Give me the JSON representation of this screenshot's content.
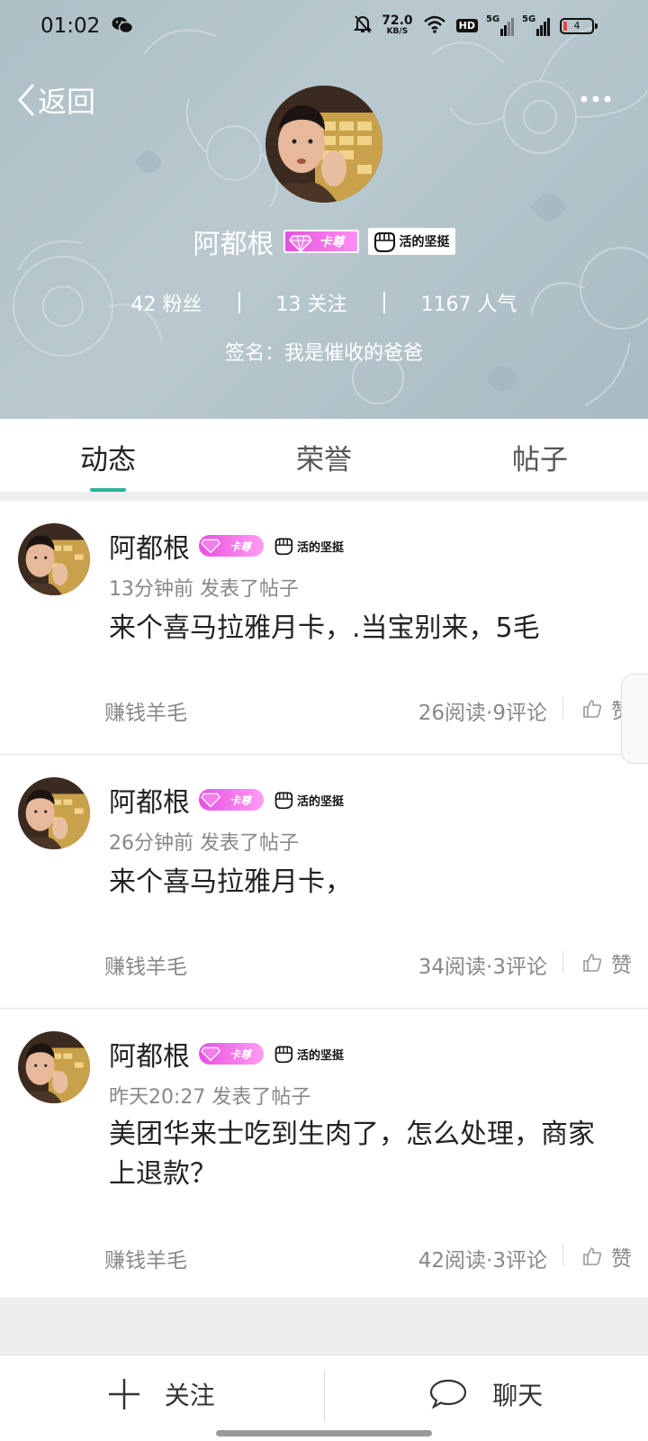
{
  "status_bar": {
    "time": "01:02",
    "net_speed_value": "72.0",
    "net_speed_unit": "KB/S",
    "hd_label": "HD",
    "signal_1_label": "5G",
    "signal_2_label": "5G",
    "battery_level": "4",
    "icons": [
      "wechat-icon",
      "mute-bell-icon",
      "wifi-icon",
      "signal-icon",
      "battery-icon"
    ]
  },
  "nav": {
    "back_label": "返回",
    "more_icon": "more-dots-icon"
  },
  "profile": {
    "name": "阿都根",
    "vip_badge_text": "卡尊",
    "motto_badge_text": "活的坚挺",
    "stats": {
      "fans": "42 粉丝",
      "following": "13 关注",
      "popularity": "1167 人气"
    },
    "signature": "签名：我是催收的爸爸"
  },
  "tabs": [
    {
      "label": "动态",
      "active": true
    },
    {
      "label": "荣誉",
      "active": false
    },
    {
      "label": "帖子",
      "active": false
    }
  ],
  "posts": [
    {
      "author": "阿都根",
      "vip_badge_text": "卡尊",
      "motto_badge_text": "活的坚挺",
      "meta": "13分钟前  发表了帖子",
      "content": "来个喜马拉雅月卡，.当宝别来，5毛",
      "tag": "赚钱羊毛",
      "stats": "26阅读·9评论",
      "like_label": "赞"
    },
    {
      "author": "阿都根",
      "vip_badge_text": "卡尊",
      "motto_badge_text": "活的坚挺",
      "meta": "26分钟前  发表了帖子",
      "content": "来个喜马拉雅月卡，",
      "tag": "赚钱羊毛",
      "stats": "34阅读·3评论",
      "like_label": "赞"
    },
    {
      "author": "阿都根",
      "vip_badge_text": "卡尊",
      "motto_badge_text": "活的坚挺",
      "meta": "昨天20:27  发表了帖子",
      "content": "美团华来士吃到生肉了，怎么处理，商家上退款？",
      "tag": "赚钱羊毛",
      "stats": "42阅读·3评论",
      "like_label": "赞"
    }
  ],
  "bottom_bar": {
    "follow_label": "关注",
    "chat_label": "聊天"
  },
  "colors": {
    "accent": "#2bb59a",
    "header_bg": "#b4c5cc",
    "vip_pink": "#e84fe0"
  }
}
